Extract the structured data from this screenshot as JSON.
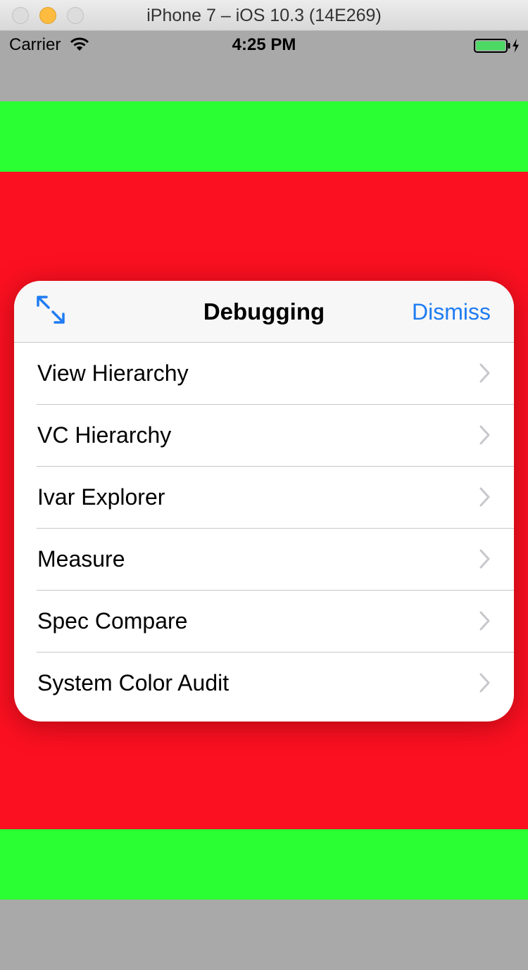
{
  "window": {
    "title": "iPhone 7 – iOS 10.3 (14E269)"
  },
  "status_bar": {
    "carrier": "Carrier",
    "time": "4:25 PM"
  },
  "colors": {
    "background": "#a9a9a9",
    "green_band": "#2aff33",
    "red_area": "#fb1021",
    "accent": "#1f7cf2"
  },
  "panel": {
    "title": "Debugging",
    "dismiss_label": "Dismiss",
    "items": [
      {
        "label": "View Hierarchy"
      },
      {
        "label": "VC Hierarchy"
      },
      {
        "label": "Ivar Explorer"
      },
      {
        "label": "Measure"
      },
      {
        "label": "Spec Compare"
      },
      {
        "label": "System Color Audit"
      }
    ]
  }
}
